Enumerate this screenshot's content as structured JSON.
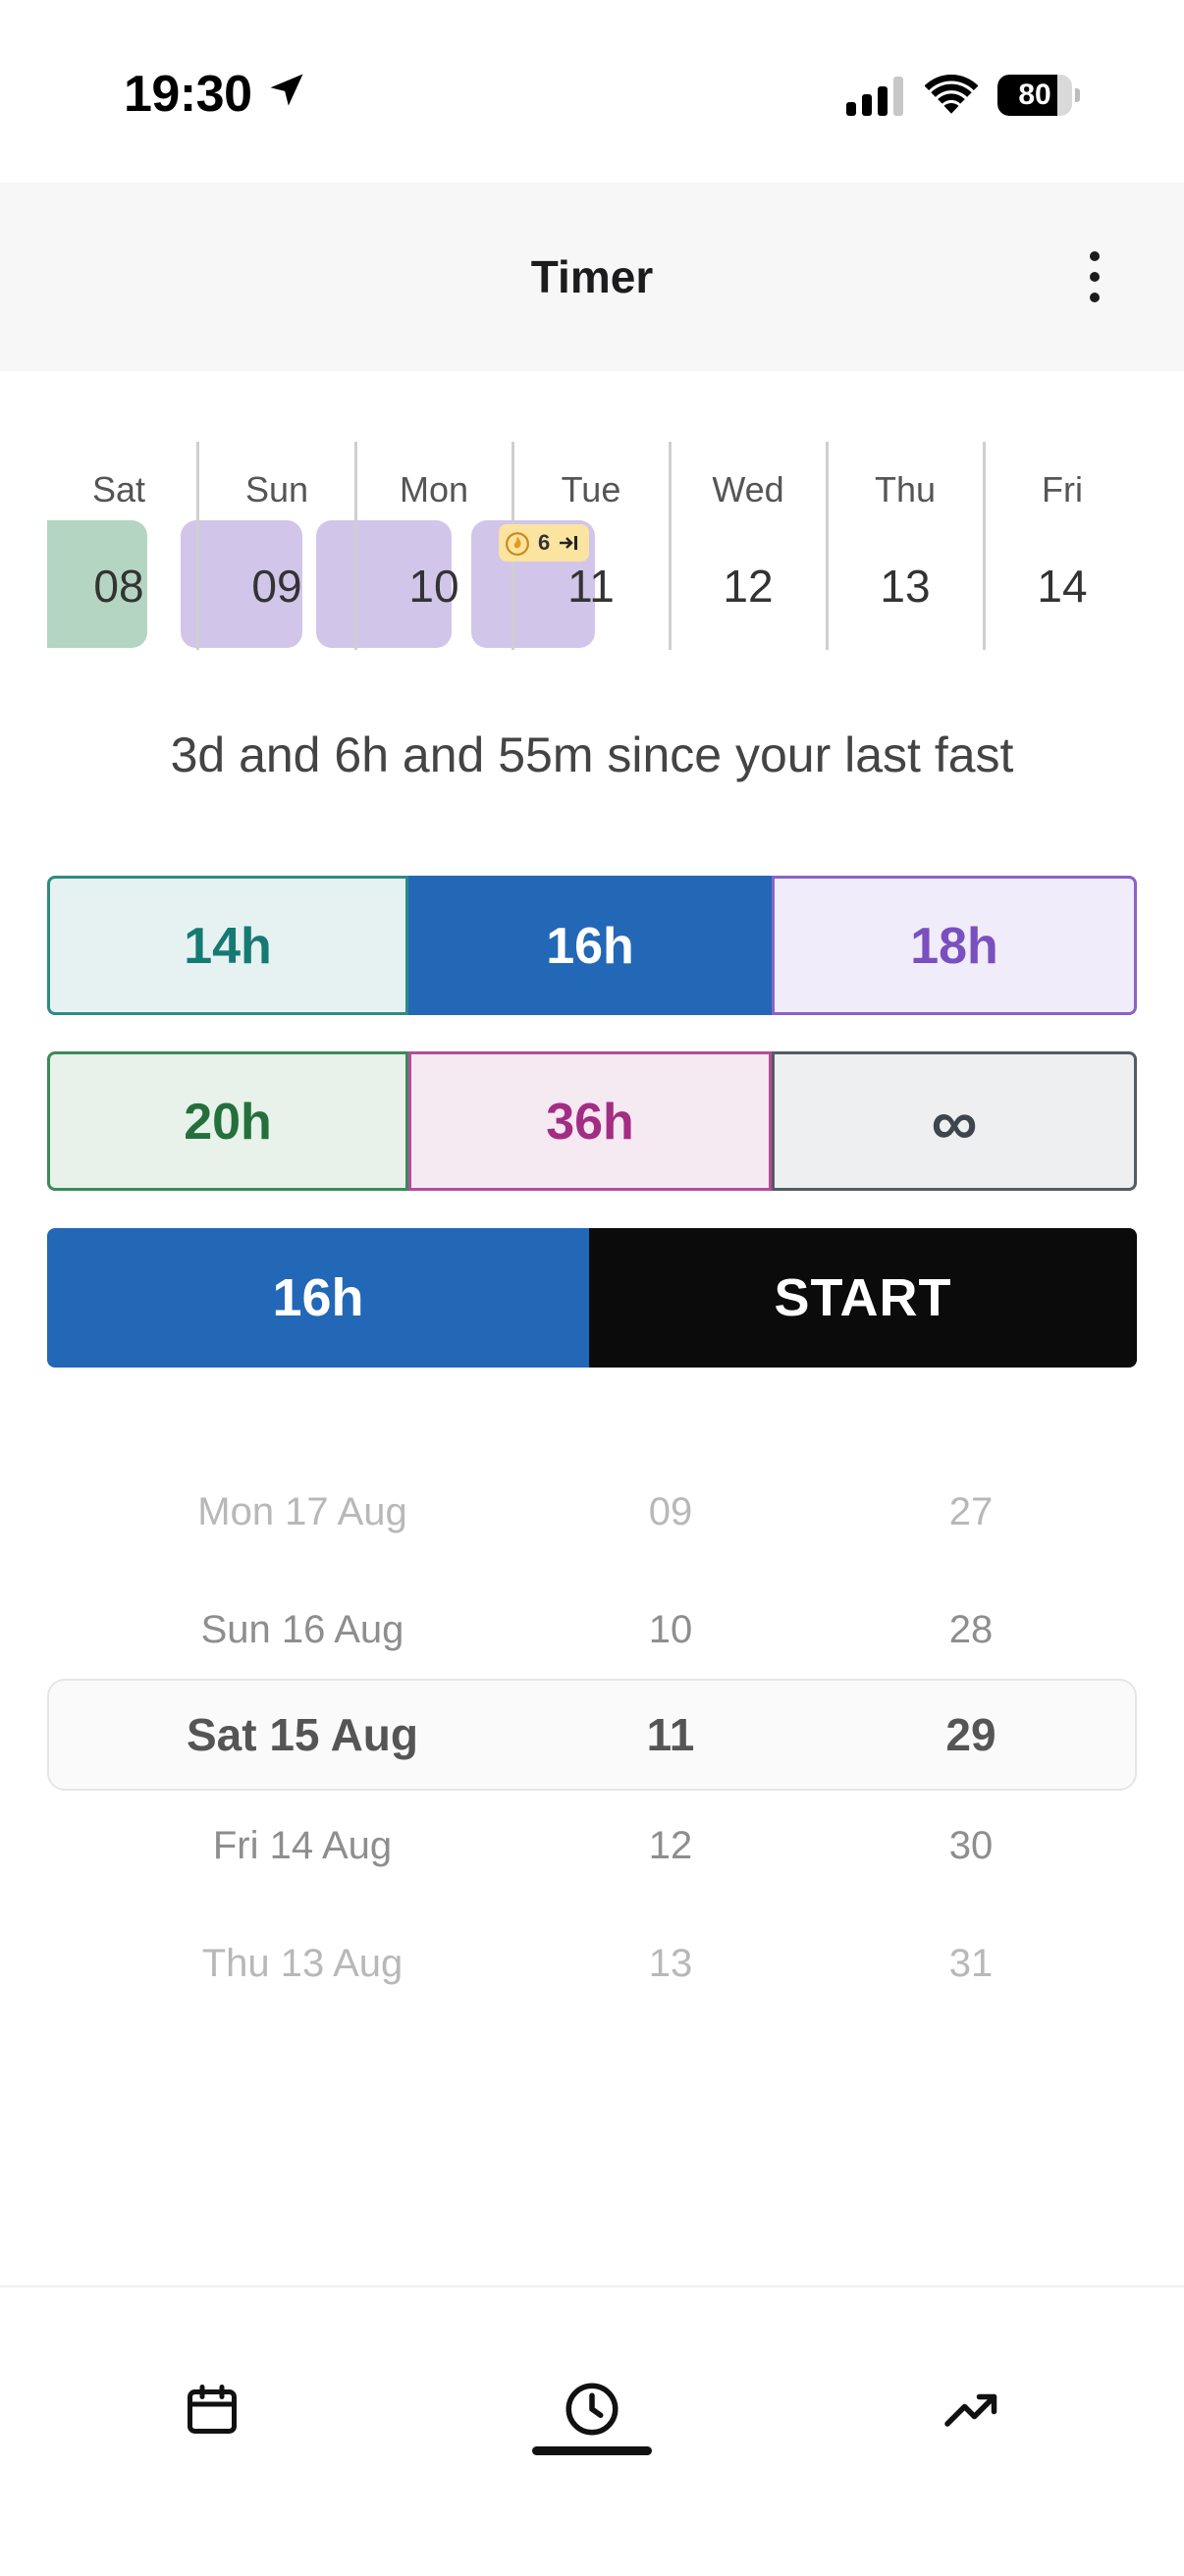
{
  "status_bar": {
    "time": "19:30",
    "battery": "80",
    "battery_level": 0.8,
    "icons": [
      "location-arrow-icon",
      "cellular-signal-icon",
      "wifi-icon",
      "battery-icon"
    ]
  },
  "header": {
    "title": "Timer",
    "more_icon": "more-vertical-icon"
  },
  "week": {
    "days": [
      {
        "name": "Sat",
        "number": "08"
      },
      {
        "name": "Sun",
        "number": "09"
      },
      {
        "name": "Mon",
        "number": "10"
      },
      {
        "name": "Tue",
        "number": "11"
      },
      {
        "name": "Wed",
        "number": "12"
      },
      {
        "name": "Thu",
        "number": "13"
      },
      {
        "name": "Fri",
        "number": "14"
      }
    ],
    "streak_badge": {
      "count": "6",
      "icon": "flame-icon",
      "arrow_icon": "arrow-right-to-bar-icon",
      "color": "#fbe3a0"
    },
    "colors": {
      "completed_fast": "#b4d5c1",
      "fast": "#d2c5ea"
    }
  },
  "since_text": "3d and 6h and 55m since your last fast",
  "durations": {
    "row1": [
      "14h",
      "16h",
      "18h"
    ],
    "row2": [
      "20h",
      "36h",
      "∞"
    ],
    "selected": "16h"
  },
  "start_row": {
    "duration": "16h",
    "start_label": "START",
    "accent": "#2367b7"
  },
  "picker": {
    "dates": [
      "Mon 17 Aug",
      "Sun 16 Aug",
      "Sat 15 Aug",
      "Fri 14 Aug",
      "Thu 13 Aug"
    ],
    "hours": [
      "09",
      "10",
      "11",
      "12",
      "13"
    ],
    "minutes": [
      "27",
      "28",
      "29",
      "30",
      "31"
    ],
    "selected": {
      "date": "Sat 15 Aug",
      "hour": "11",
      "minute": "29"
    }
  },
  "nav": {
    "items": [
      {
        "icon": "calendar-icon",
        "active": false
      },
      {
        "icon": "clock-icon",
        "active": true
      },
      {
        "icon": "trending-up-icon",
        "active": false
      }
    ]
  }
}
